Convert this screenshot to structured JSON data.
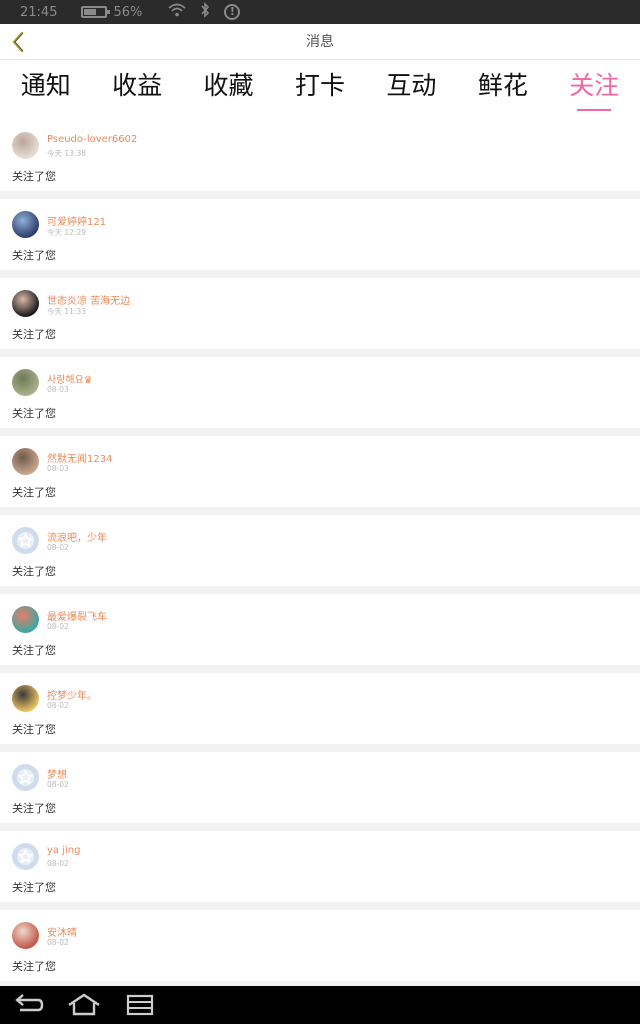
{
  "status": {
    "time": "21:45",
    "battery_percent": "56%",
    "battery_level": 0.56,
    "icons": [
      "battery-icon",
      "wifi-icon",
      "bluetooth-icon",
      "info-icon"
    ]
  },
  "header": {
    "title": "消息",
    "back_icon": "chevron-left-icon"
  },
  "tabs": [
    {
      "label": "通知",
      "active": false
    },
    {
      "label": "收益",
      "active": false
    },
    {
      "label": "收藏",
      "active": false
    },
    {
      "label": "打卡",
      "active": false
    },
    {
      "label": "互动",
      "active": false
    },
    {
      "label": "鲜花",
      "active": false
    },
    {
      "label": "关注",
      "active": true
    }
  ],
  "items": [
    {
      "name": "Pseudo-lover6602",
      "time": "今天 13:38",
      "message": "关注了您",
      "avatar": "photo",
      "avatar_colors": [
        "#e8dcd4",
        "#b9a69a"
      ]
    },
    {
      "name": "可爱婷婷121",
      "time": "今天 12:29",
      "message": "关注了您",
      "avatar": "photo",
      "avatar_colors": [
        "#2e3f6a",
        "#8fb0d8"
      ]
    },
    {
      "name": "世态炎凉 苦海无边",
      "time": "今天 11:33",
      "message": "关注了您",
      "avatar": "photo",
      "avatar_colors": [
        "#1c1c1c",
        "#d9b8a8"
      ]
    },
    {
      "name": "사랑해요♛",
      "time": "08-03",
      "message": "关注了您",
      "avatar": "photo",
      "avatar_colors": [
        "#a7b08a",
        "#6f7a55"
      ]
    },
    {
      "name": "然默无闻1234",
      "time": "08-03",
      "message": "关注了您",
      "avatar": "photo",
      "avatar_colors": [
        "#c9a48c",
        "#6e5a4c"
      ]
    },
    {
      "name": "流浪吧，少年",
      "time": "08-02",
      "message": "关注了您",
      "avatar": "default"
    },
    {
      "name": "最爱爆裂飞车",
      "time": "08-02",
      "message": "关注了您",
      "avatar": "photo",
      "avatar_colors": [
        "#3ea7a0",
        "#e67c6a"
      ]
    },
    {
      "name": "控梦少年。",
      "time": "08-02",
      "message": "关注了您",
      "avatar": "photo",
      "avatar_colors": [
        "#e8c060",
        "#3a3a3a"
      ]
    },
    {
      "name": "梦想",
      "time": "08-02",
      "message": "关注了您",
      "avatar": "default"
    },
    {
      "name": "ya jing",
      "time": "08-02",
      "message": "关注了您",
      "avatar": "default"
    },
    {
      "name": "安沐晴",
      "time": "08-02",
      "message": "关注了您",
      "avatar": "photo",
      "avatar_colors": [
        "#c25a4a",
        "#f0d8cc"
      ]
    }
  ],
  "navbar": {
    "icons": [
      "back-icon",
      "home-icon",
      "recent-apps-icon"
    ]
  },
  "colors": {
    "accent": "#ee6aa6",
    "username": "#e88c5c",
    "back_arrow": "#b0a030"
  }
}
